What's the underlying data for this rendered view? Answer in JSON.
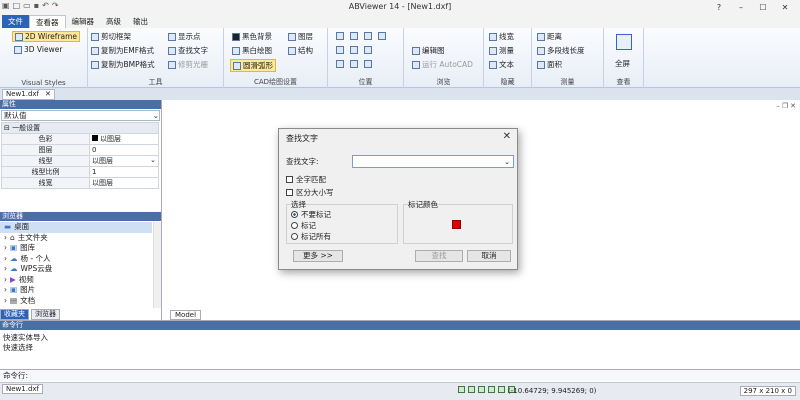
{
  "window": {
    "title": "ABViewer 14 - [New1.dxf]",
    "controls": [
      "?",
      "–",
      "☐",
      "✕"
    ]
  },
  "menu_tabs": [
    "文件",
    "查看器",
    "编辑器",
    "高级",
    "输出"
  ],
  "ribbon": {
    "visual_styles": {
      "items": [
        "2D Wireframe",
        "3D Viewer"
      ],
      "label": "Visual Styles"
    },
    "tools": {
      "items": [
        "剪切框架",
        "复制为EMF格式",
        "复制为BMP格式",
        "显示点",
        "查找文字",
        "修剪光栅"
      ],
      "label": "工具"
    },
    "cad_settings": {
      "items": [
        "黑色背景",
        "黑白绘图",
        "圆滑弧形",
        "图层",
        "结构"
      ],
      "label": "CAD绘图设置"
    },
    "position": {
      "label": "位置"
    },
    "browse": {
      "items": [
        "编辑图",
        "运行 AutoCAD"
      ],
      "label": "浏览"
    },
    "hide": {
      "items": [
        "线宽",
        "测量",
        "文本"
      ],
      "label": "隐藏"
    },
    "measure": {
      "items": [
        "距离",
        "多段线长度",
        "面积"
      ],
      "label": "测量"
    },
    "view": {
      "items": [
        "全屏"
      ],
      "label": "查看"
    }
  },
  "doc_tab": {
    "label": "New1.dxf",
    "close": "✕"
  },
  "properties": {
    "header": "属性",
    "dropdown": "默认值",
    "category": "一般设置",
    "rows": [
      {
        "key": "色彩",
        "value": "以图层"
      },
      {
        "key": "图层",
        "value": "0"
      },
      {
        "key": "线型",
        "value": "以图层"
      },
      {
        "key": "线型比例",
        "value": "1"
      },
      {
        "key": "线宽",
        "value": "以图层"
      }
    ]
  },
  "browser": {
    "header": "浏览器",
    "items": [
      "桌面",
      "主文件夹",
      "图库",
      "杨 - 个人",
      "WPS云盘",
      "视频",
      "图片",
      "文档"
    ],
    "tabs": [
      "收藏夹",
      "浏览器"
    ]
  },
  "canvas": {
    "model_tab": "Model"
  },
  "command": {
    "header": "命令行",
    "lines": [
      "快速实体导入",
      "快速选择"
    ],
    "input_label": "命令行:"
  },
  "status": {
    "file": "New1.dxf",
    "coords": "(-10.64729; 9.945269; 0)",
    "size": "297 x 210 x 0"
  },
  "dialog": {
    "title": "查找文字",
    "find_label": "查找文字:",
    "find_value": "",
    "match_whole": "全字匹配",
    "match_case": "区分大小写",
    "select_group": "选择",
    "radio": [
      "不要标记",
      "标记",
      "标记所有"
    ],
    "color_group": "标记颜色",
    "marker_color": "#e00000",
    "more_button": "更多 >>",
    "find_button": "查找",
    "cancel_button": "取消"
  }
}
